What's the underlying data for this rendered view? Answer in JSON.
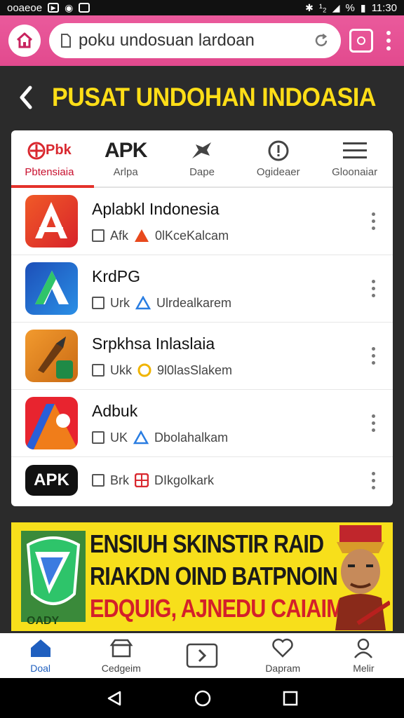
{
  "status_bar": {
    "left_text": "ooaeoe",
    "signal_text": "¹₂",
    "battery_text": "%",
    "time": "11:30"
  },
  "browser": {
    "url": "poku undosuan lardoan"
  },
  "page": {
    "title": "PUSAT UNDOHAN INDOASIA"
  },
  "tabs": [
    {
      "icon": "pbk-logo-icon",
      "icon_text": "Pbk",
      "label": "Pbtensiaia",
      "active": true
    },
    {
      "icon": "apk-text-icon",
      "icon_text": "APK",
      "label": "Arlpa"
    },
    {
      "icon": "bird-icon",
      "label": "Dape"
    },
    {
      "icon": "alert-circle-icon",
      "label": "Ogideaer"
    },
    {
      "icon": "hamburger-icon",
      "label": "Gloonaiar"
    }
  ],
  "apps": [
    {
      "name": "Aplabkl Indonesia",
      "meta_code": "Afk",
      "meta_dev": "0lKceKalcam",
      "icon": "red-a-app-icon",
      "badge_color": "#e8491d"
    },
    {
      "name": "KrdPG",
      "meta_code": "Urk",
      "meta_dev": "Ulrdealkarem",
      "icon": "blue-a-app-icon",
      "badge_color": "#2a7de1"
    },
    {
      "name": "Srpkhsa Inlaslaia",
      "meta_code": "Ukk",
      "meta_dev": "9l0lasSlakem",
      "icon": "rocket-app-icon",
      "badge_color": "#f0b400"
    },
    {
      "name": "Adbuk",
      "meta_code": "UK",
      "meta_dev": "Dbolahalkam",
      "icon": "multicolor-a-app-icon",
      "badge_color": "#2a7de1"
    },
    {
      "name": "",
      "meta_code": "Brk",
      "meta_dev": "DIkgolkark",
      "icon": "apk-app-icon",
      "icon_text": "APK",
      "badge_color": "#d9282f"
    }
  ],
  "banner": {
    "line1": "ENSIUH SKINSTIR RAID",
    "line2": "RIAKDN OIND BATPNOIN",
    "line3": "EDQUIG, AJNEDU CAIAIM",
    "brand_label": "OADY"
  },
  "bottom_nav": [
    {
      "label": "Doal",
      "icon": "home-icon",
      "active": true
    },
    {
      "label": "Cedgeim",
      "icon": "store-icon"
    },
    {
      "label": "",
      "icon": "forward-box-icon"
    },
    {
      "label": "Dapram",
      "icon": "heart-icon"
    },
    {
      "label": "Melir",
      "icon": "user-icon"
    }
  ],
  "colors": {
    "browser_bar": "#e24a8e",
    "title_yellow": "#ffde17",
    "tab_active": "#e4322b",
    "nav_active": "#1f5fbf",
    "banner_bg": "#f7df1b"
  }
}
